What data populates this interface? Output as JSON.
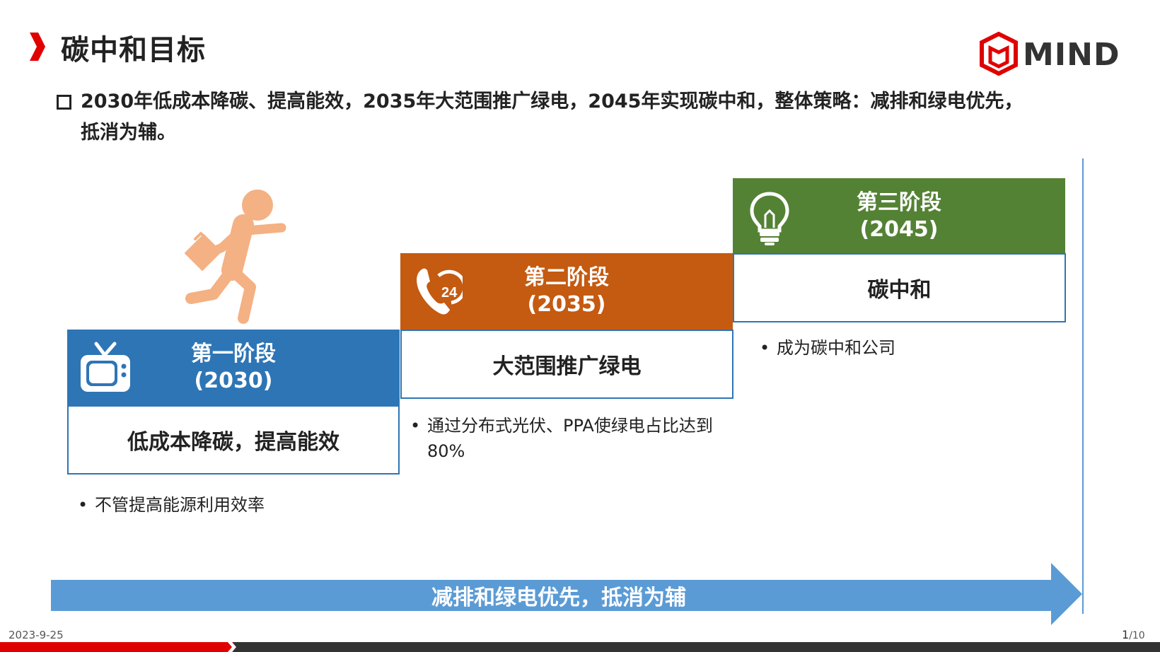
{
  "header": {
    "title": "碳中和目标",
    "logo_text": "MIND"
  },
  "summary": {
    "line1": "2030年低成本降碳、提高能效，2035年大范围推广绿电，2045年实现碳中和，整体策略：减排和绿电优先，",
    "line2": "抵消为辅。"
  },
  "stages": [
    {
      "title": "第一阶段",
      "year": "(2030)",
      "goal": "低成本降碳，提高能效",
      "notes": [
        "不管提高能源利用效率"
      ],
      "icon": "tv-icon",
      "color": "#2e75b6"
    },
    {
      "title": "第二阶段",
      "year": "(2035)",
      "goal": "大范围推广绿电",
      "notes": [
        "通过分布式光伏、PPA使绿电占比达到",
        "80%"
      ],
      "icon": "phone-24-icon",
      "color": "#c55a11"
    },
    {
      "title": "第三阶段",
      "year": "(2045)",
      "goal": "碳中和",
      "notes": [
        "成为碳中和公司"
      ],
      "icon": "lightbulb-icon",
      "color": "#548235"
    }
  ],
  "arrow": {
    "label": "减排和绿电优先，抵消为辅",
    "color": "#5b9bd5"
  },
  "footer": {
    "date": "2023-9-25",
    "page_current": "1",
    "page_total": "/10"
  },
  "icons": [
    "chevron-right-icon",
    "mind-logo-icon",
    "runner-icon",
    "tv-icon",
    "phone-24-icon",
    "lightbulb-icon"
  ]
}
